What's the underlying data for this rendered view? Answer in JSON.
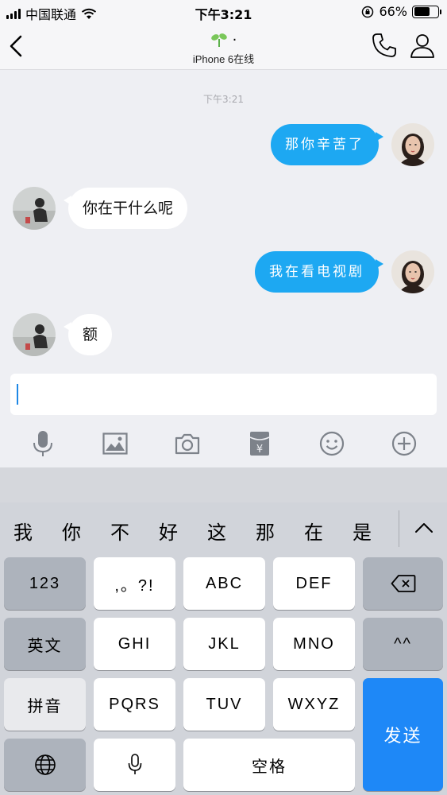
{
  "status_bar": {
    "carrier": "中国联通",
    "time": "下午3:21",
    "battery_percent": "66%",
    "battery_level": 0.66
  },
  "nav": {
    "contact_name": "·",
    "contact_status": "iPhone 6在线"
  },
  "chat": {
    "timestamp": "下午3:21",
    "messages": [
      {
        "direction": "out",
        "text": "那你辛苦了"
      },
      {
        "direction": "in",
        "text": "你在干什么呢"
      },
      {
        "direction": "out",
        "text": "我在看电视剧"
      },
      {
        "direction": "in",
        "text": "额"
      }
    ]
  },
  "input": {
    "value": ""
  },
  "toolbar": [
    "microphone-icon",
    "image-icon",
    "camera-icon",
    "red-packet-icon",
    "emoji-icon",
    "plus-icon"
  ],
  "keyboard": {
    "candidates": [
      "我",
      "你",
      "不",
      "好",
      "这",
      "那",
      "在",
      "是"
    ],
    "keys": {
      "num": "123",
      "punct": ",。?!",
      "abc": "ABC",
      "def": "DEF",
      "english": "英文",
      "ghi": "GHI",
      "jkl": "JKL",
      "mno": "MNO",
      "emoticon": "^^",
      "pinyin": "拼音",
      "pqrs": "PQRS",
      "tuv": "TUV",
      "wxyz": "WXYZ",
      "send": "发送",
      "space": "空格"
    }
  },
  "colors": {
    "accent": "#1da8f2",
    "send_key": "#1e88f7",
    "background": "#eeeff3"
  }
}
